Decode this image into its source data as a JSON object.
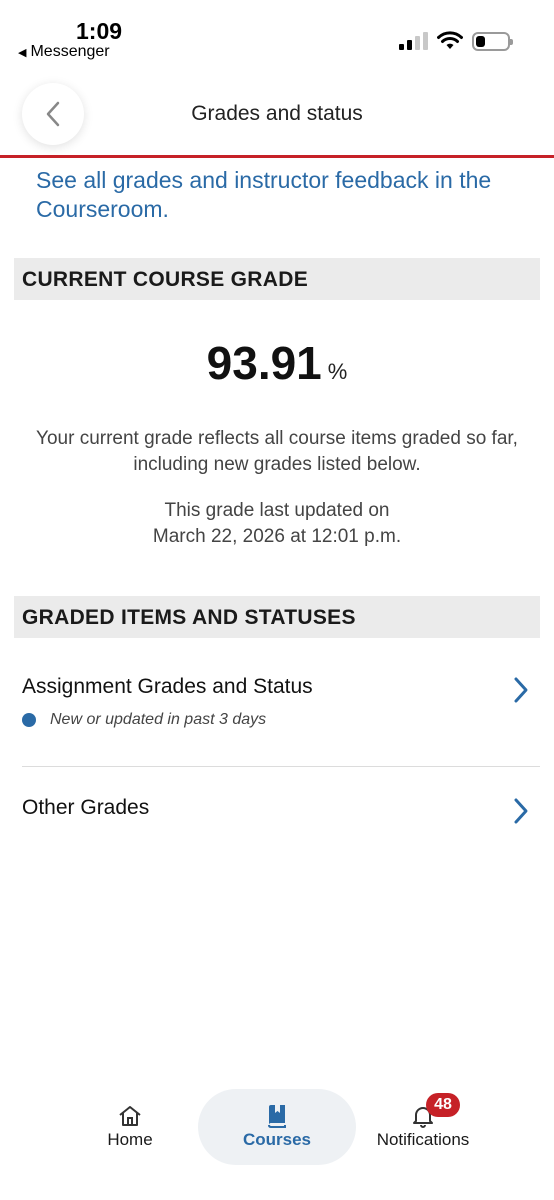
{
  "status_bar": {
    "time": "1:09",
    "back_app": "Messenger"
  },
  "header": {
    "title": "Grades and status"
  },
  "courseroom_link": "See all grades and instructor feedback in the Courseroom.",
  "current_grade": {
    "section_title": "CURRENT COURSE GRADE",
    "value": "93.91",
    "unit": "%",
    "description": "Your current grade reflects all course items graded so far, including new grades listed below.",
    "updated_line1": "This grade last updated on",
    "updated_line2": "March 22, 2026 at 12:01 p.m."
  },
  "graded_items": {
    "section_title": "GRADED ITEMS AND STATUSES",
    "items": [
      {
        "label": "Assignment Grades and Status",
        "sub": "New or updated in past 3 days"
      },
      {
        "label": "Other Grades"
      }
    ]
  },
  "tabbar": {
    "home": "Home",
    "courses": "Courses",
    "notifications": "Notifications",
    "notification_count": "48"
  },
  "colors": {
    "accent": "#2a6aa6",
    "brand_red": "#c62127"
  }
}
